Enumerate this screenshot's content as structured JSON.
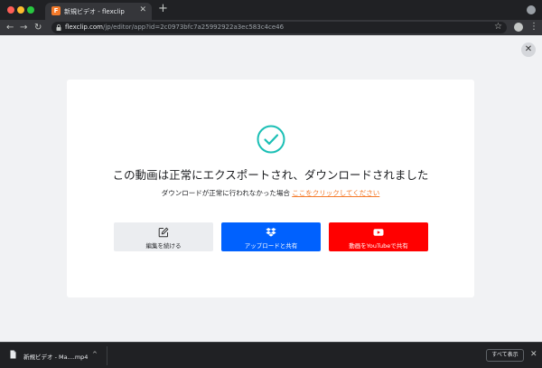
{
  "browser": {
    "tab": {
      "favicon_letter": "F",
      "title": "新規ビデオ - flexclip",
      "close_glyph": "✕"
    },
    "new_tab_glyph": "+",
    "nav": {
      "back": "←",
      "forward": "→",
      "reload": "↻"
    },
    "address": {
      "domain": "flexclip.com",
      "path": "/jp/editor/app?id=2c0973bfc7a25992922a3ec583c4ce46"
    },
    "star_glyph": "☆",
    "kebab_glyph": "⋮"
  },
  "modal": {
    "close_glyph": "✕",
    "title": "この動画は正常にエクスポートされ、ダウンロードされました",
    "subtitle_prefix": "ダウンロードが正常に行われなかった場合",
    "subtitle_link": "ここをクリックしてください",
    "buttons": {
      "edit": "編集を続ける",
      "dropbox": "アップロードと共有",
      "youtube": "動画をYouTubeで共有"
    },
    "colors": {
      "accent": "#1bbfb5",
      "dropbox": "#0061fe",
      "youtube": "#ff0000",
      "link": "#f47a2a"
    }
  },
  "download_shelf": {
    "file_name": "新規ビデオ - Ma....mp4",
    "caret_glyph": "^",
    "show_all": "すべて表示",
    "close_glyph": "✕"
  }
}
